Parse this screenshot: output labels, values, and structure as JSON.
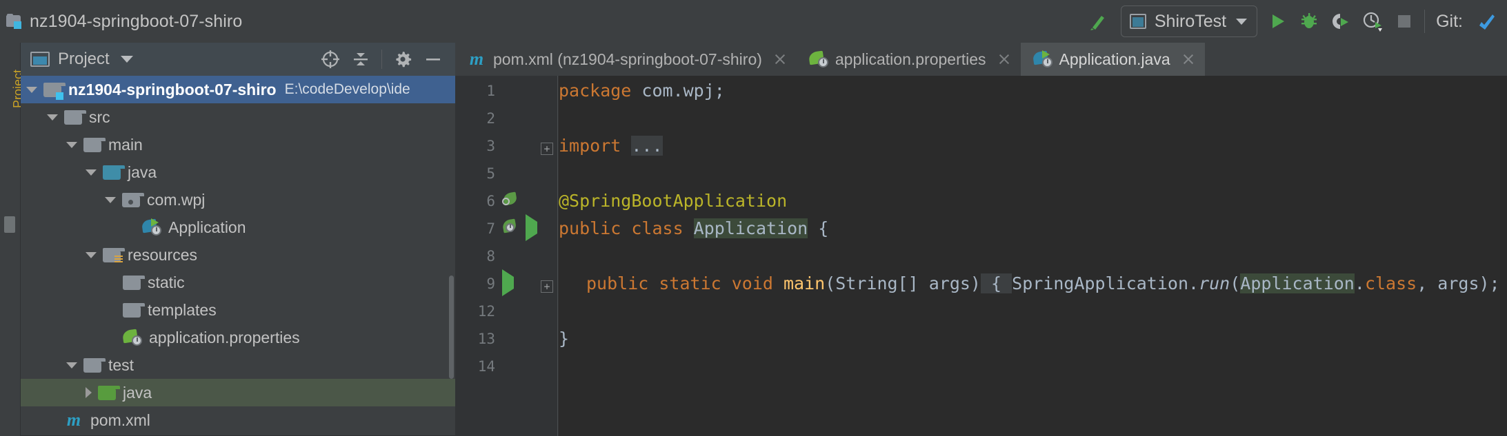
{
  "window": {
    "title": "nz1904-springboot-07-shiro",
    "project_icon": "module-icon"
  },
  "toolbar": {
    "make_icon": "build-hammer-icon",
    "run_config": {
      "label": "ShiroTest",
      "icon": "run-configuration-icon",
      "dropdown_icon": "chevron-down-icon"
    },
    "run_icon": "run-icon",
    "debug_icon": "debug-bug-icon",
    "run_coverage_icon": "run-with-coverage-icon",
    "profile_icon": "profiler-icon",
    "stop_icon": "stop-icon",
    "git_label": "Git:",
    "git_update_icon": "update-project-icon"
  },
  "left_strip": {
    "label": "Project"
  },
  "project_panel": {
    "header": {
      "title": "Project",
      "window_icon": "project-window-icon",
      "dropdown_icon": "chevron-down-icon",
      "actions": [
        {
          "name": "scroll-from-source-icon",
          "title": "Select Opened File"
        },
        {
          "name": "collapse-all-icon",
          "title": "Collapse All"
        },
        {
          "name": "settings-gear-icon",
          "title": "Settings"
        },
        {
          "name": "hide-minimize-icon",
          "title": "Hide"
        }
      ]
    },
    "tree": [
      {
        "label": "nz1904-springboot-07-shiro",
        "path": "E:\\codeDevelop\\ide",
        "icon": "module-folder-icon",
        "arrow": "down",
        "depth": 0,
        "state": "selected",
        "bold": true
      },
      {
        "label": "src",
        "icon": "folder-icon",
        "arrow": "down",
        "depth": 1,
        "state": "normal",
        "bold": false
      },
      {
        "label": "main",
        "icon": "folder-icon",
        "arrow": "down",
        "depth": 2,
        "state": "normal",
        "bold": false
      },
      {
        "label": "java",
        "icon": "source-root-folder-icon",
        "arrow": "down",
        "depth": 3,
        "state": "normal",
        "bold": false
      },
      {
        "label": "com.wpj",
        "icon": "package-folder-icon",
        "arrow": "down",
        "depth": 4,
        "state": "normal",
        "bold": false
      },
      {
        "label": "Application",
        "icon": "spring-boot-class-icon",
        "arrow": "none",
        "depth": 5,
        "state": "normal",
        "bold": false
      },
      {
        "label": "resources",
        "icon": "resources-folder-icon",
        "arrow": "down",
        "depth": 3,
        "state": "normal",
        "bold": false
      },
      {
        "label": "static",
        "icon": "folder-icon",
        "arrow": "none",
        "depth": 4,
        "state": "normal",
        "bold": false
      },
      {
        "label": "templates",
        "icon": "folder-icon",
        "arrow": "none",
        "depth": 4,
        "state": "normal",
        "bold": false
      },
      {
        "label": "application.properties",
        "icon": "spring-properties-icon",
        "arrow": "none",
        "depth": 4,
        "state": "normal",
        "bold": false
      },
      {
        "label": "test",
        "icon": "folder-icon",
        "arrow": "down",
        "depth": 2,
        "state": "normal",
        "bold": false
      },
      {
        "label": "java",
        "icon": "test-source-root-folder-icon",
        "arrow": "right",
        "depth": 3,
        "state": "green-highlight",
        "bold": false
      },
      {
        "label": "pom.xml",
        "icon": "maven-file-icon",
        "arrow": "none",
        "depth": 1,
        "state": "normal",
        "bold": false
      }
    ]
  },
  "editor": {
    "tabs": [
      {
        "label": "pom.xml (nz1904-springboot-07-shiro)",
        "icon": "maven-file-icon",
        "active": false,
        "close_icon": "close-icon"
      },
      {
        "label": "application.properties",
        "icon": "spring-properties-icon",
        "active": false,
        "close_icon": "close-icon"
      },
      {
        "label": "Application.java",
        "icon": "spring-boot-class-icon",
        "active": true,
        "close_icon": "close-icon"
      }
    ],
    "line_numbers": [
      "1",
      "2",
      "3",
      "5",
      "6",
      "7",
      "8",
      "9",
      "12",
      "13",
      "14"
    ],
    "code": {
      "l1_kw": "package",
      "l1_pkg": " com.wpj;",
      "l3_kw": "import",
      "l3_fold": "...",
      "l6_annotation": "@SpringBootApplication",
      "l7_a": "public class ",
      "l7_name": "Application",
      "l7_b": " {",
      "l9_a": "public static void ",
      "l9_main": "main",
      "l9_sig": "(String[] args)",
      "l9_open": " { ",
      "l9_cls": "SpringApplication.",
      "l9_run": "run",
      "l9_p1": "(",
      "l9_app": "Application",
      "l9_dot": ".",
      "l9_kwclass": "class",
      "l9_rest": ", args); ",
      "l9_close": "}",
      "l13_brace": "}"
    },
    "gutter_icons": {
      "line6": "spring-bean-icon",
      "line7_bean": "spring-boot-run-icon",
      "line7_run": "run-gutter-icon",
      "line9_run": "run-gutter-icon",
      "line3_fold": "+",
      "line9_fold": "+"
    }
  },
  "colors": {
    "accent_blue": "#3f6190",
    "keyword_orange": "#cc7832",
    "annotation_yellow": "#bbb529",
    "method_yellow": "#ffc66d",
    "text_grey": "#a9b7c6",
    "editor_bg": "#2b2b2b",
    "panel_bg": "#3c3f41",
    "spring_green": "#6db33f"
  }
}
